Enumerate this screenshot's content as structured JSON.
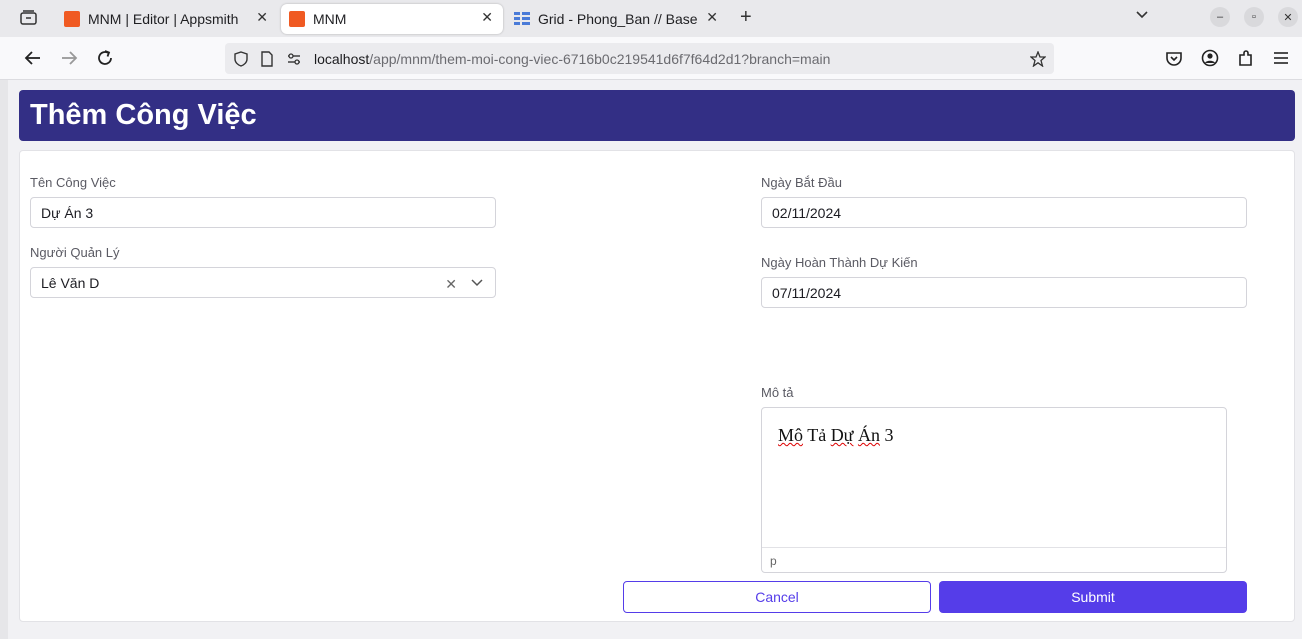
{
  "browser": {
    "tabs": [
      {
        "label": "MNM | Editor | Appsmith",
        "icon": "appsmith-favicon",
        "color": "#f05a22",
        "active": false
      },
      {
        "label": "MNM",
        "icon": "appsmith-favicon",
        "color": "#f05a22",
        "active": true
      },
      {
        "label": "Grid - Phong_Ban // Base",
        "icon": "baserow-favicon",
        "color": "#4a7bd8",
        "active": false
      }
    ],
    "url_host": "localhost",
    "url_path": "/app/mnm/them-moi-cong-viec-6716b0c219541d6f7f64d2d1?branch=main"
  },
  "form": {
    "title": "Thêm Công Việc",
    "ten_cong_viec": {
      "label": "Tên Công Việc",
      "value": "Dự Án 3"
    },
    "nguoi_quan_ly": {
      "label": "Người Quản Lý",
      "value": "Lê Văn D"
    },
    "ngay_bat_dau": {
      "label": "Ngày Bắt Đầu",
      "value": "02/11/2024"
    },
    "ngay_hoan_thanh": {
      "label": "Ngày Hoàn Thành Dự Kiến",
      "value": "07/11/2024"
    },
    "mo_ta": {
      "label": "Mô tả",
      "value_parts": [
        "Mô",
        "Tả",
        "Dự",
        "Án",
        "3"
      ],
      "status": "p"
    },
    "cancel_label": "Cancel",
    "submit_label": "Submit"
  },
  "colors": {
    "header_bg": "#332f85",
    "accent": "#553de9"
  }
}
